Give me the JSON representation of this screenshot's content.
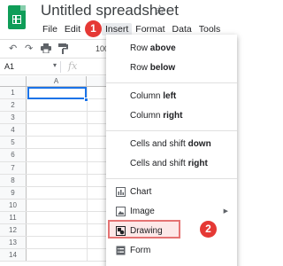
{
  "app": {
    "title": "Untitled spreadsheet",
    "star_icon": "star-outline-icon"
  },
  "menubar": {
    "items": [
      "File",
      "Edit",
      "Insert",
      "Format",
      "Data",
      "Tools"
    ],
    "active": "Insert"
  },
  "toolbar": {
    "zoom": "100"
  },
  "formula_bar": {
    "cell_ref": "A1",
    "fx": "fx"
  },
  "grid": {
    "column_header": "A",
    "rows": [
      "1",
      "2",
      "3",
      "4",
      "5",
      "6",
      "7",
      "8",
      "9",
      "10",
      "11",
      "12",
      "13",
      "14"
    ]
  },
  "insert_menu": {
    "rows_above": [
      "Row ",
      "above"
    ],
    "rows_below": [
      "Row ",
      "below"
    ],
    "col_left": [
      "Column ",
      "left"
    ],
    "col_right": [
      "Column ",
      "right"
    ],
    "cells_down": [
      "Cells and shift ",
      "down"
    ],
    "cells_right": [
      "Cells and shift ",
      "right"
    ],
    "chart": "Chart",
    "image": "Image",
    "drawing": "Drawing",
    "form": "Form"
  },
  "callouts": {
    "first": "1",
    "second": "2"
  },
  "colors": {
    "sheets_green": "#0f9d58",
    "selection_blue": "#1a73e8",
    "callout_red": "#e53935",
    "highlight_border": "#e57373"
  }
}
